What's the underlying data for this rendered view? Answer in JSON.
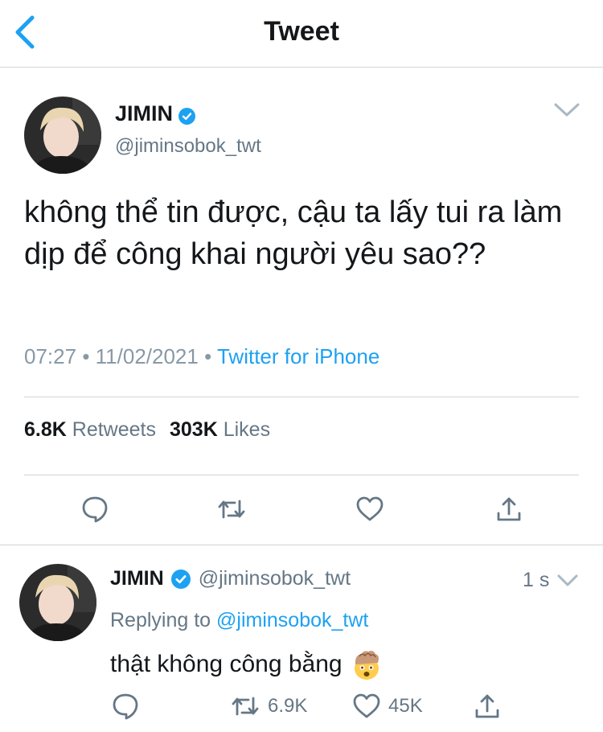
{
  "header": {
    "title": "Tweet"
  },
  "tweet": {
    "author_name": "JIMIN",
    "handle": "@jiminsobok_twt",
    "text": "không thể tin được, cậu ta lấy tui ra làm dịp để công khai người yêu sao??",
    "time": "07:27",
    "date": "11/02/2021",
    "separator": "•",
    "source": "Twitter for iPhone",
    "retweets_count": "6.8K",
    "retweets_label": "Retweets",
    "likes_count": "303K",
    "likes_label": "Likes"
  },
  "reply": {
    "author_name": "JIMIN",
    "handle": "@jiminsobok_twt",
    "time": "1 s",
    "replying_label": "Replying to",
    "replying_to": "@jiminsobok_twt",
    "text": "thật không công bằng",
    "emoji": "exploding-head-emoji",
    "retweets_count": "6.9K",
    "likes_count": "45K"
  },
  "icons": {
    "back": "chevron-left-icon",
    "caret": "chevron-down-icon",
    "verified": "verified-badge-icon",
    "reply": "reply-icon",
    "retweet": "retweet-icon",
    "like": "heart-icon",
    "share": "share-icon"
  },
  "colors": {
    "accent": "#1da1f2",
    "text": "#14171a",
    "secondary": "#657786",
    "meta": "#8899a6",
    "divider": "#cfd5da"
  }
}
